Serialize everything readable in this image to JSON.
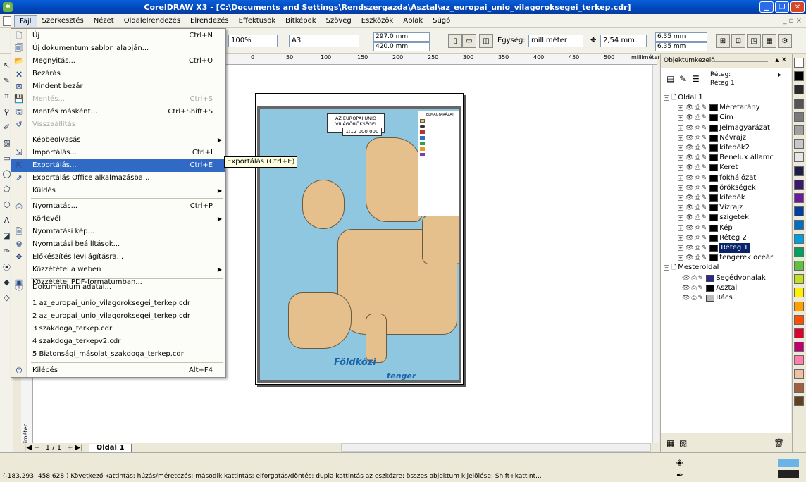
{
  "window": {
    "title": "CorelDRAW X3 - [C:\\Documents and Settings\\Rendszergazda\\Asztal\\az_europai_unio_vilagoroksegei_terkep.cdr]"
  },
  "menubar": [
    "Fájl",
    "Szerkesztés",
    "Nézet",
    "Oldalelrendezés",
    "Elrendezés",
    "Effektusok",
    "Bitképek",
    "Szöveg",
    "Eszközök",
    "Ablak",
    "Súgó"
  ],
  "propbar": {
    "zoom": "100%",
    "paper": "A3",
    "width": "297.0 mm",
    "height": "420.0 mm",
    "unit_label": "Egység:",
    "unit": "milliméter",
    "nudge": "2,54 mm",
    "dup_x": "6.35 mm",
    "dup_y": "6.35 mm"
  },
  "ruler": {
    "ticks": [
      "0",
      "50",
      "100",
      "150",
      "200",
      "250",
      "300",
      "350",
      "400",
      "450",
      "500"
    ],
    "unit": "milliméter",
    "vunit": "milliméter"
  },
  "map": {
    "title_line1": "AZ EURÓPAI UNIÓ",
    "title_line2": "VILÁGÖRÖKSÉGEI",
    "scale": "1:12 000 000",
    "legend_title": "JELMAGYARÁZAT",
    "sea1": "Földközi",
    "sea2": "tenger"
  },
  "file_menu": {
    "items": [
      {
        "label": "Új",
        "shortcut": "Ctrl+N",
        "icon": "new-doc-icon"
      },
      {
        "label": "Új dokumentum sablon alapján...",
        "shortcut": "",
        "icon": "template-icon"
      },
      {
        "label": "Megnyitás...",
        "shortcut": "Ctrl+O",
        "icon": "open-folder-icon"
      },
      {
        "label": "Bezárás",
        "shortcut": "",
        "icon": "close-doc-icon"
      },
      {
        "label": "Mindent bezár",
        "shortcut": "",
        "icon": "close-all-icon"
      },
      {
        "label": "Mentés...",
        "shortcut": "Ctrl+S",
        "icon": "save-icon"
      },
      {
        "label": "Mentés másként...",
        "shortcut": "Ctrl+Shift+S",
        "icon": "save-as-icon"
      },
      {
        "label": "Visszaállítás",
        "shortcut": "",
        "icon": "revert-icon"
      },
      {
        "label": "Képbeolvasás",
        "shortcut": "",
        "icon": ""
      },
      {
        "label": "Importálás...",
        "shortcut": "Ctrl+I",
        "icon": "import-icon"
      },
      {
        "label": "Exportálás...",
        "shortcut": "Ctrl+E",
        "icon": "export-icon"
      },
      {
        "label": "Exportálás Office alkalmazásba...",
        "shortcut": "",
        "icon": "export-office-icon"
      },
      {
        "label": "Küldés",
        "shortcut": "",
        "icon": ""
      },
      {
        "label": "Nyomtatás...",
        "shortcut": "Ctrl+P",
        "icon": "print-icon"
      },
      {
        "label": "Körlevél",
        "shortcut": "",
        "icon": ""
      },
      {
        "label": "Nyomtatási kép...",
        "shortcut": "",
        "icon": "print-preview-icon"
      },
      {
        "label": "Nyomtatási beállítások...",
        "shortcut": "",
        "icon": "print-setup-icon"
      },
      {
        "label": "Előkészítés levilágításra...",
        "shortcut": "",
        "icon": "prepress-icon"
      },
      {
        "label": "Közzététel a weben",
        "shortcut": "",
        "icon": ""
      },
      {
        "label": "Közzététel PDF-formátumban...",
        "shortcut": "",
        "icon": "pdf-icon"
      },
      {
        "label": "Dokumentum adatai...",
        "shortcut": "",
        "icon": "info-icon"
      },
      {
        "label": "1 az_europai_unio_vilagoroksegei_terkep.cdr",
        "shortcut": "",
        "icon": ""
      },
      {
        "label": "2 az_europai_unio_vilagoroksegei_terkep.cdr",
        "shortcut": "",
        "icon": ""
      },
      {
        "label": "3 szakdoga_terkep.cdr",
        "shortcut": "",
        "icon": ""
      },
      {
        "label": "4 szakdoga_terkepv2.cdr",
        "shortcut": "",
        "icon": ""
      },
      {
        "label": "5 Biztonsági_másolat_szakdoga_terkep.cdr",
        "shortcut": "",
        "icon": ""
      },
      {
        "label": "Kilépés",
        "shortcut": "Alt+F4",
        "icon": "exit-icon"
      }
    ]
  },
  "tooltip": "Exportálás (Ctrl+E)",
  "bottombar": {
    "pages": "1 / 1",
    "page_tab": "Oldal 1"
  },
  "docker": {
    "title": "Objektumkezelő",
    "layer_label": "Réteg:",
    "layer_value": "Réteg 1",
    "tree": [
      {
        "label": "Oldal 1",
        "color": ""
      },
      {
        "label": "Méretarány",
        "color": "#000000"
      },
      {
        "label": "Cím",
        "color": "#000000"
      },
      {
        "label": "Jelmagyarázat",
        "color": "#000000"
      },
      {
        "label": "Névrajz",
        "color": "#000000"
      },
      {
        "label": "kifedők2",
        "color": "#000000"
      },
      {
        "label": "Benelux államc",
        "color": "#000000"
      },
      {
        "label": "Keret",
        "color": "#000000"
      },
      {
        "label": "fokhálózat",
        "color": "#000000"
      },
      {
        "label": "örökségek",
        "color": "#000000"
      },
      {
        "label": "kifedők",
        "color": "#000000"
      },
      {
        "label": "Vízrajz",
        "color": "#000000"
      },
      {
        "label": "szigetek",
        "color": "#000000"
      },
      {
        "label": "Kép",
        "color": "#000000"
      },
      {
        "label": "Réteg 2",
        "color": "#000000"
      },
      {
        "label": "Réteg 1",
        "color": "#000000"
      },
      {
        "label": "tengerek oceár",
        "color": "#000000"
      },
      {
        "label": "Mesteroldal",
        "color": ""
      },
      {
        "label": "Segédvonalak",
        "color": "#2a2a8a"
      },
      {
        "label": "Asztal",
        "color": "#000000"
      },
      {
        "label": "Rács",
        "color": "#bbbbbb"
      }
    ]
  },
  "palette": [
    "#ffffff",
    "#000000",
    "#2b2b2b",
    "#555555",
    "#7a7a7a",
    "#a0a0a0",
    "#c8c8c8",
    "#e6e6e6",
    "#1e1e4a",
    "#3a1a6a",
    "#6a1a9a",
    "#003fa0",
    "#0070c0",
    "#00a0e0",
    "#00a060",
    "#60c040",
    "#c0e020",
    "#fff000",
    "#ffa000",
    "#ff5000",
    "#e00030",
    "#c00070",
    "#ff80b0",
    "#f0c0a0",
    "#a06040",
    "#604020"
  ],
  "status": {
    "text": "(-183,293; 458,628 )  Következő kattintás: húzás/méretezés; második kattintás: elforgatás/döntés; dupla kattintás az eszközre: összes objektum kijelölése; Shift+kattint..."
  }
}
